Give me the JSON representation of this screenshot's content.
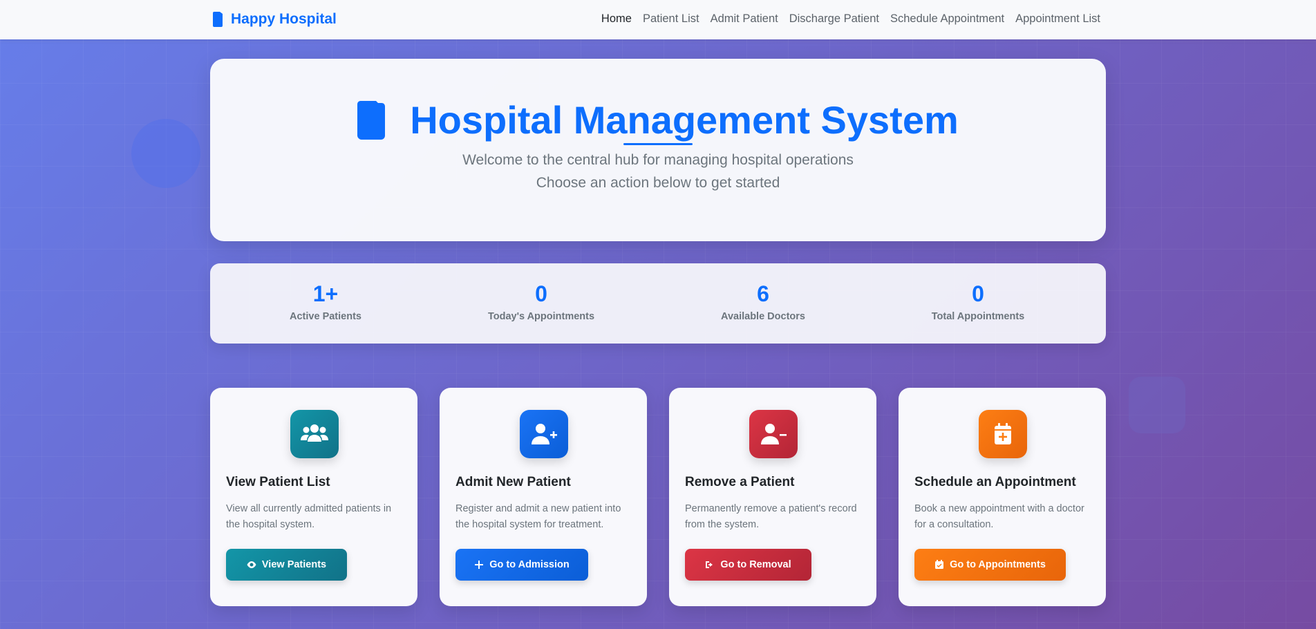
{
  "navbar": {
    "brand": "Happy Hospital",
    "links": [
      "Home",
      "Patient List",
      "Admit Patient",
      "Discharge Patient",
      "Schedule Appointment",
      "Appointment List"
    ],
    "active": "Home"
  },
  "hero": {
    "title": "Hospital Management System",
    "subtitle_line1": "Welcome to the central hub for managing hospital operations",
    "subtitle_line2": "Choose an action below to get started"
  },
  "stats": [
    {
      "value": "1+",
      "label": "Active Patients"
    },
    {
      "value": "0",
      "label": "Today's Appointments"
    },
    {
      "value": "6",
      "label": "Available Doctors"
    },
    {
      "value": "0",
      "label": "Total Appointments"
    }
  ],
  "cards": [
    {
      "title": "View Patient List",
      "desc": "View all currently admitted patients in the hospital system.",
      "button": "View Patients",
      "icon": "users-icon",
      "color": "#117a8b"
    },
    {
      "title": "Admit New Patient",
      "desc": "Register and admit a new patient into the hospital system for treatment.",
      "button": "Go to Admission",
      "icon": "user-plus-icon",
      "color": "#0d6efd"
    },
    {
      "title": "Remove a Patient",
      "desc": "Permanently remove a patient's record from the system.",
      "button": "Go to Removal",
      "icon": "user-minus-icon",
      "color": "#dc3545"
    },
    {
      "title": "Schedule an Appointment",
      "desc": "Book a new appointment with a doctor for a consultation.",
      "button": "Go to Appointments",
      "icon": "calendar-plus-icon",
      "color": "#fd7e14"
    }
  ],
  "colors": {
    "primary": "#0d6efd",
    "teal": "#117a8b",
    "danger": "#dc3545",
    "warning": "#fd7e14"
  }
}
